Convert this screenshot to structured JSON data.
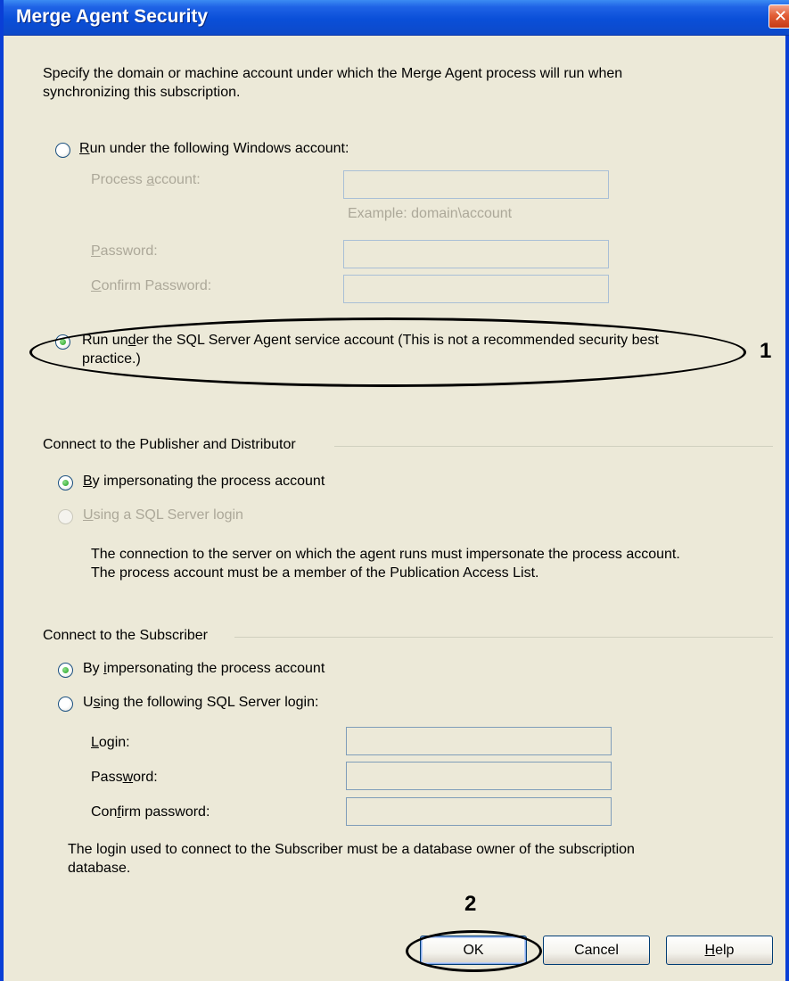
{
  "window": {
    "title": "Merge Agent Security",
    "close_glyph": "✕"
  },
  "intro": {
    "line1": "Specify the domain or machine account under which the Merge Agent process will run when",
    "line2": "synchronizing this subscription."
  },
  "agent_account": {
    "windows_option": {
      "prefix": "",
      "mnemonic": "R",
      "rest": "un under the following Windows account:",
      "checked": false
    },
    "process_account": {
      "prefix": "Process ",
      "mnemonic": "a",
      "rest": "ccount:",
      "value": ""
    },
    "example": "Example: domain\\account",
    "password": {
      "prefix": "",
      "mnemonic": "P",
      "rest": "assword:",
      "value": ""
    },
    "confirm_password": {
      "prefix": "",
      "mnemonic": "C",
      "rest": "onfirm Password:",
      "value": ""
    },
    "sql_agent_option": {
      "prefix": "Run un",
      "mnemonic": "d",
      "rest": "er the SQL Server Agent service account (This is not a recommended security best",
      "line2": "practice.)",
      "checked": true
    }
  },
  "publisher": {
    "group_label": "Connect to the Publisher and Distributor",
    "impersonate_option": {
      "prefix": "",
      "mnemonic": "B",
      "rest": "y impersonating the process account",
      "checked": true
    },
    "sql_login_option": {
      "prefix": "",
      "mnemonic": "U",
      "rest": "sing a SQL Server login",
      "checked": false,
      "enabled": false
    },
    "note_line1": "The connection to the server on which the agent runs must impersonate the process account.",
    "note_line2": "The process account must be a member of the Publication Access List."
  },
  "subscriber": {
    "group_label": "Connect to the Subscriber",
    "impersonate_option": {
      "prefix": "By ",
      "mnemonic": "i",
      "rest": "mpersonating the process account",
      "checked": true
    },
    "sql_login_option": {
      "prefix": "U",
      "mnemonic": "s",
      "rest": "ing the following SQL Server login:",
      "checked": false
    },
    "login": {
      "prefix": "",
      "mnemonic": "L",
      "rest": "ogin:",
      "value": ""
    },
    "password": {
      "prefix": "Pass",
      "mnemonic": "w",
      "rest": "ord:",
      "value": ""
    },
    "confirm_password": {
      "prefix": "Con",
      "mnemonic": "f",
      "rest": "irm password:",
      "value": ""
    },
    "note_line1": "The login used to connect to the Subscriber must be a database owner of the subscription",
    "note_line2": "database."
  },
  "buttons": {
    "ok": "OK",
    "cancel": "Cancel",
    "help": {
      "prefix": "",
      "mnemonic": "H",
      "rest": "elp"
    }
  },
  "annotations": {
    "callout_1": "1",
    "callout_2": "2"
  }
}
